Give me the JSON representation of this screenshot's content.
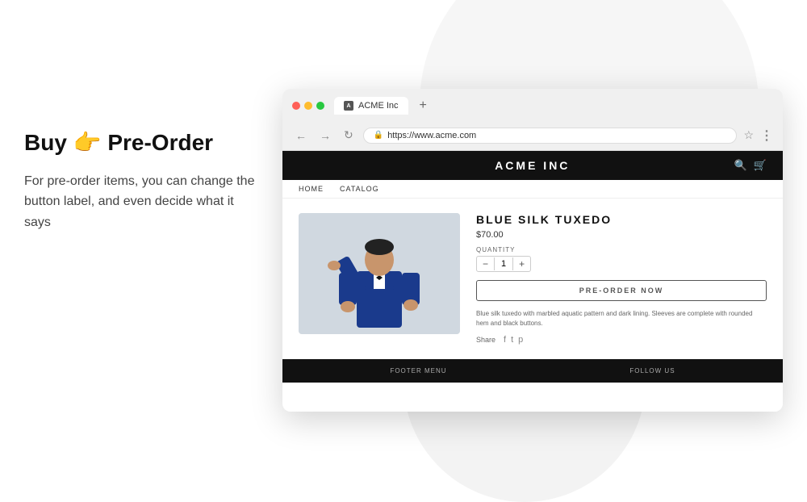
{
  "background": {
    "color": "#ffffff"
  },
  "left_panel": {
    "headline_part1": "Buy ",
    "emoji": "👉",
    "headline_part2": " Pre-Order",
    "description": "For pre-order items, you can change the button label, and even decide what it says"
  },
  "browser": {
    "tab_favicon_label": "A",
    "tab_title": "ACME Inc",
    "tab_new_button": "+",
    "nav_back": "←",
    "nav_forward": "→",
    "nav_refresh": "↻",
    "address_url": "https://www.acme.com",
    "star_icon": "☆",
    "more_icon": "⋮"
  },
  "website": {
    "header": {
      "logo": "ACME INC",
      "search_icon": "🔍",
      "cart_icon": "🛒"
    },
    "nav": {
      "items": [
        {
          "label": "HOME",
          "href": "#"
        },
        {
          "label": "CATALOG",
          "href": "#"
        }
      ]
    },
    "product": {
      "title": "BLUE SILK TUXEDO",
      "price": "$70.00",
      "quantity_label": "QUANTITY",
      "quantity_value": "1",
      "qty_minus": "−",
      "qty_plus": "+",
      "button_label": "PRE-ORDER NOW",
      "description": "Blue silk tuxedo with marbled aquatic pattern and dark lining. Sleeves are complete with rounded hem and black buttons.",
      "share_label": "Share"
    },
    "footer": {
      "col1": "FOOTER MENU",
      "col2": "FOLLOW US"
    }
  }
}
